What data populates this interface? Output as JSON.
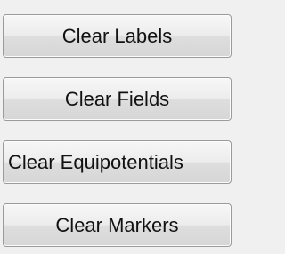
{
  "buttons": {
    "clear_labels": "Clear Labels",
    "clear_fields": "Clear Fields",
    "clear_equipotentials": "Clear Equipotentials",
    "clear_markers": "Clear Markers"
  }
}
